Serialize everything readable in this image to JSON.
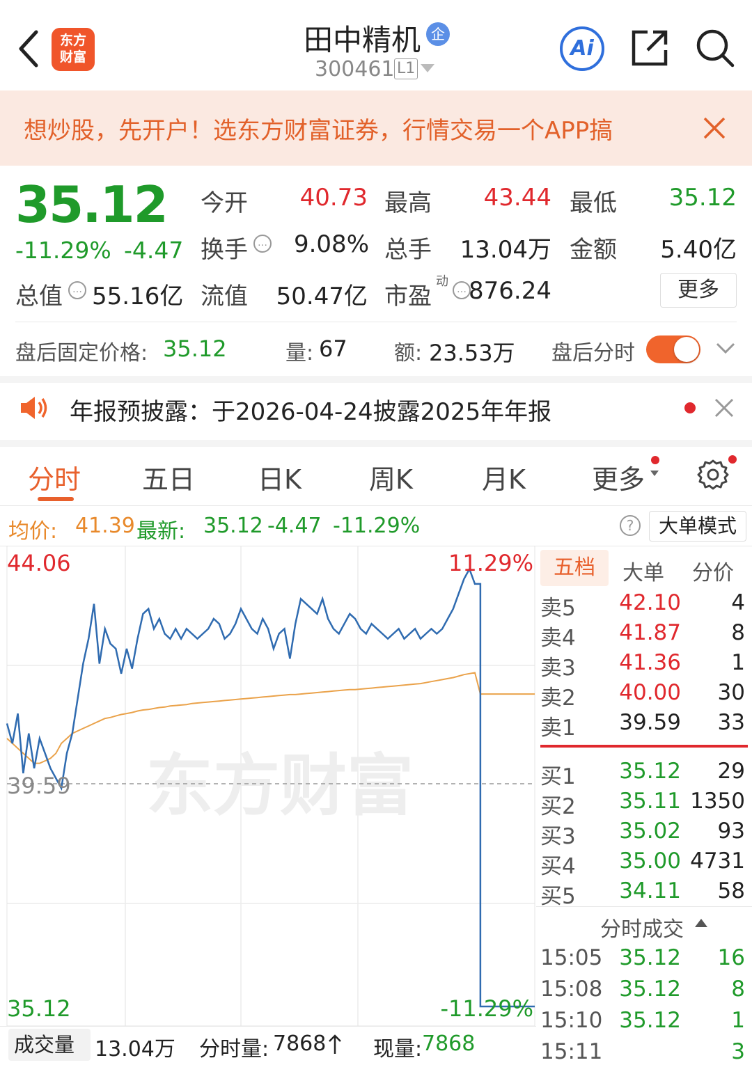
{
  "header": {
    "title": "田中精机",
    "code": "300461",
    "level": "L1",
    "badge_char": "企",
    "logo_text": "东方财富",
    "ai_label": "Ai"
  },
  "banner": {
    "text": "想炒股，先开户！选东方财富证券，行情交易一个APP搞"
  },
  "quote": {
    "price": "35.12",
    "change_pct": "-11.29%",
    "change_amt": "-4.47",
    "open_label": "今开",
    "open": "40.73",
    "high_label": "最高",
    "high": "43.44",
    "low_label": "最低",
    "low": "35.12",
    "turnover_label": "换手",
    "turnover": "9.08%",
    "volume_label": "总手",
    "volume": "13.04万",
    "amount_label": "金额",
    "amount": "5.40亿",
    "mktcap_label": "总值",
    "mktcap": "55.16亿",
    "float_label": "流值",
    "float_cap": "50.47亿",
    "pe_label": "市盈",
    "pe_sup": "动",
    "pe": "876.24",
    "more_label": "更多"
  },
  "after_hours": {
    "price_label": "盘后固定价格:",
    "price": "35.12",
    "qty_label": "量:",
    "qty": "67",
    "amt_label": "额:",
    "amt": "23.53万",
    "toggle_label": "盘后分时",
    "toggle_on": true
  },
  "notice": {
    "text": "年报预披露：于2026-04-24披露2025年年报"
  },
  "tabs": [
    "分时",
    "五日",
    "日K",
    "周K",
    "月K",
    "更多"
  ],
  "active_tab": 0,
  "chart_info": {
    "avg_label": "均价:",
    "avg": "41.39",
    "last_label": "最新:",
    "last": "35.12",
    "chg": "-4.47",
    "chg_pct": "-11.29%",
    "mode_button": "大单模式"
  },
  "chart_data": {
    "type": "line",
    "y_top_label": "44.06",
    "y_mid_label": "39.59",
    "y_bottom_label": "35.12",
    "pct_top_label": "11.29%",
    "pct_bottom_label": "-11.29%",
    "ylim": [
      35.12,
      44.06
    ],
    "prev_close": 39.59,
    "watermark": "东方财富",
    "series": [
      {
        "values": [
          40.8,
          40.4,
          41.0,
          39.8,
          40.6,
          39.9,
          40.5,
          40.2,
          39.9,
          39.7,
          39.5,
          40.2,
          40.6,
          41.3,
          42.0,
          42.5,
          43.2,
          42.0,
          42.7,
          42.4,
          42.3,
          41.8,
          42.3,
          41.9,
          42.5,
          43.0,
          43.1,
          42.7,
          42.9,
          42.6,
          42.5,
          42.7,
          42.5,
          42.7,
          42.6,
          42.5,
          42.6,
          42.7,
          42.9,
          42.8,
          42.5,
          42.6,
          42.8,
          43.1,
          42.9,
          42.7,
          42.6,
          42.9,
          42.7,
          42.3,
          42.6,
          42.7,
          42.1,
          42.8,
          43.3,
          43.2,
          43.1,
          43.0,
          43.3,
          42.9,
          42.7,
          42.6,
          42.8,
          43.0,
          42.9,
          42.7,
          42.6,
          42.8,
          42.7,
          42.6,
          42.5,
          42.6,
          42.7,
          42.5,
          42.6,
          42.7,
          42.5,
          42.6,
          42.7,
          42.6,
          42.7,
          42.9,
          43.1,
          43.4,
          43.7,
          43.9,
          43.6,
          35.12,
          35.12,
          35.12,
          35.12,
          35.12,
          35.12,
          35.12,
          35.12,
          35.12,
          35.12,
          35.12
        ]
      },
      {
        "values": [
          40.5,
          40.4,
          40.3,
          40.2,
          40.1,
          40.0,
          40.0,
          40.05,
          40.1,
          40.2,
          40.4,
          40.5,
          40.6,
          40.65,
          40.7,
          40.75,
          40.8,
          40.85,
          40.9,
          40.92,
          40.95,
          40.98,
          41.0,
          41.02,
          41.05,
          41.07,
          41.08,
          41.1,
          41.12,
          41.13,
          41.15,
          41.16,
          41.17,
          41.18,
          41.2,
          41.21,
          41.22,
          41.23,
          41.24,
          41.25,
          41.26,
          41.27,
          41.28,
          41.29,
          41.3,
          41.31,
          41.32,
          41.33,
          41.34,
          41.35,
          41.36,
          41.37,
          41.38,
          41.38,
          41.39,
          41.4,
          41.41,
          41.42,
          41.43,
          41.44,
          41.45,
          41.46,
          41.47,
          41.48,
          41.48,
          41.49,
          41.5,
          41.51,
          41.52,
          41.53,
          41.54,
          41.55,
          41.56,
          41.57,
          41.58,
          41.59,
          41.6,
          41.62,
          41.64,
          41.66,
          41.68,
          41.7,
          41.72,
          41.75,
          41.78,
          41.8,
          41.82,
          41.39,
          41.39,
          41.39,
          41.39,
          41.39,
          41.39,
          41.39,
          41.39,
          41.39,
          41.39,
          41.39
        ]
      }
    ]
  },
  "orderbook": {
    "tabs": [
      "五档",
      "大单",
      "分价"
    ],
    "sell": [
      {
        "label": "卖5",
        "price": "42.10",
        "vol": "4",
        "color": "#e0282d"
      },
      {
        "label": "卖4",
        "price": "41.87",
        "vol": "8",
        "color": "#e0282d"
      },
      {
        "label": "卖3",
        "price": "41.36",
        "vol": "1",
        "color": "#e0282d"
      },
      {
        "label": "卖2",
        "price": "40.00",
        "vol": "30",
        "color": "#e0282d"
      },
      {
        "label": "卖1",
        "price": "39.59",
        "vol": "33",
        "color": "#222222"
      }
    ],
    "buy": [
      {
        "label": "买1",
        "price": "35.12",
        "vol": "29",
        "color": "#1f9a2a"
      },
      {
        "label": "买2",
        "price": "35.11",
        "vol": "1350",
        "color": "#1f9a2a"
      },
      {
        "label": "买3",
        "price": "35.02",
        "vol": "93",
        "color": "#1f9a2a"
      },
      {
        "label": "买4",
        "price": "35.00",
        "vol": "4731",
        "color": "#1f9a2a"
      },
      {
        "label": "买5",
        "price": "34.11",
        "vol": "58",
        "color": "#1f9a2a"
      }
    ],
    "trades_title": "分时成交",
    "trades": [
      {
        "time": "15:05",
        "price": "35.12",
        "vol": "16",
        "vol_color": "#1f9a2a"
      },
      {
        "time": "15:08",
        "price": "35.12",
        "vol": "8",
        "vol_color": "#1f9a2a"
      },
      {
        "time": "15:10",
        "price": "35.12",
        "vol": "1",
        "vol_color": "#1f9a2a"
      },
      {
        "time": "15:11",
        "price": "",
        "vol": "3",
        "vol_color": "#1f9a2a"
      }
    ]
  },
  "volume_bar": {
    "selector": "成交量",
    "total": "13.04万",
    "tick_label": "分时量:",
    "tick": "7868",
    "now_label": "现量:",
    "now": "7868"
  },
  "colors": {
    "up": "#e0282d",
    "down": "#1f9a2a",
    "accent": "#e8602c",
    "price_line": "#2f6bb0",
    "avg_line": "#eaa24a"
  }
}
